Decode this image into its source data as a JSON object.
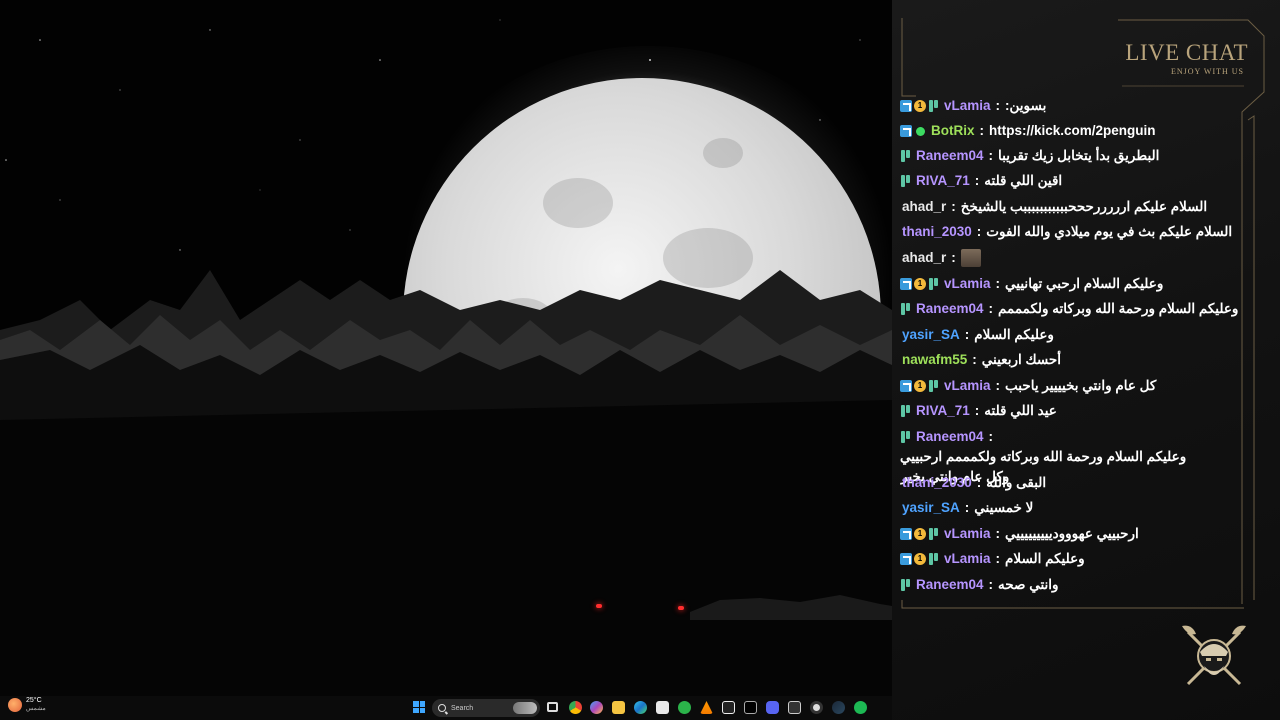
{
  "chat": {
    "title": "LIVE CHAT",
    "subtitle": "ENJOY WITH US",
    "messages": [
      {
        "badges": [
          "mod",
          "gift",
          "sub"
        ],
        "user": "vLamia",
        "color": "#b695ff",
        "text": "بسوين:"
      },
      {
        "badges": [
          "mod",
          "verified"
        ],
        "user": "BotRix",
        "color": "#9ee05a",
        "text": "https://kick.com/2penguin"
      },
      {
        "badges": [
          "sub"
        ],
        "user": "Raneem04",
        "color": "#b695ff",
        "text": "البطريق بدأ يتخابل زيك تقريبا"
      },
      {
        "badges": [
          "sub"
        ],
        "user": "RIVA_71",
        "color": "#b695ff",
        "text": "اقين اللي قلته"
      },
      {
        "badges": [],
        "user": "ahad_r",
        "color": "#e8e8e8",
        "text": "السلام عليكم ارررررحححبببببببببببب يالشيخخ"
      },
      {
        "badges": [],
        "user": "thani_2030",
        "color": "#b695ff",
        "text": "السلام عليكم بث في يوم ميلادي والله الفوت"
      },
      {
        "badges": [],
        "user": "ahad_r",
        "color": "#e8e8e8",
        "text": "",
        "emote": "emote"
      },
      {
        "badges": [
          "mod",
          "gift",
          "sub"
        ],
        "user": "vLamia",
        "color": "#b695ff",
        "text": "وعليكم السلام ارحبي تهانييي"
      },
      {
        "badges": [
          "sub"
        ],
        "user": "Raneem04",
        "color": "#b695ff",
        "text": "وعليكم السلام ورحمة الله وبركاته ولكمممم"
      },
      {
        "badges": [],
        "user": "yasir_SA",
        "color": "#4fa3ff",
        "text": "وعليكم السلام"
      },
      {
        "badges": [],
        "user": "nawafm55",
        "color": "#9ee05a",
        "text": "أحسك اربعيني"
      },
      {
        "badges": [
          "mod",
          "gift",
          "sub"
        ],
        "user": "vLamia",
        "color": "#b695ff",
        "text": "كل عام وانتي بخيييير ياحبب"
      },
      {
        "badges": [
          "sub"
        ],
        "user": "RIVA_71",
        "color": "#b695ff",
        "text": "عيد اللي قلته"
      },
      {
        "badges": [
          "sub"
        ],
        "user": "Raneem04",
        "color": "#b695ff",
        "text": "وعليكم السلام ورحمة الله وبركاته ولكمممم ارحبييي",
        "text2": "وكل عام وانتي بخير"
      },
      {
        "badges": [],
        "user": "thani_2030",
        "color": "#b695ff",
        "text": "البقى والله"
      },
      {
        "badges": [],
        "user": "yasir_SA",
        "color": "#4fa3ff",
        "text": "لا خمسيني"
      },
      {
        "badges": [
          "mod",
          "gift",
          "sub"
        ],
        "user": "vLamia",
        "color": "#b695ff",
        "text": "ارحبييي عهوووديييييييييي"
      },
      {
        "badges": [
          "mod",
          "gift",
          "sub"
        ],
        "user": "vLamia",
        "color": "#b695ff",
        "text": "وعليكم السلام"
      },
      {
        "badges": [
          "sub"
        ],
        "user": "Raneem04",
        "color": "#b695ff",
        "text": "وانتي صحه"
      }
    ]
  },
  "taskbar": {
    "weather_temp": "25°C",
    "weather_condition": "مشمس",
    "search_placeholder": "Search",
    "icons": [
      "task-view-icon",
      "chrome-icon",
      "copilot-icon",
      "file-explorer-icon",
      "edge-icon",
      "calculator-icon",
      "xbox-icon",
      "vlc-icon",
      "capcut-icon",
      "x-icon",
      "discord-icon",
      "epic-games-icon",
      "obs-icon",
      "steam-icon",
      "spotify-icon"
    ]
  },
  "colors": {
    "accent_gold": "#b9a47c",
    "vip_purple": "#b695ff",
    "bot_green": "#9ee05a",
    "user_blue": "#4fa3ff",
    "panel_bg": "#151515"
  }
}
